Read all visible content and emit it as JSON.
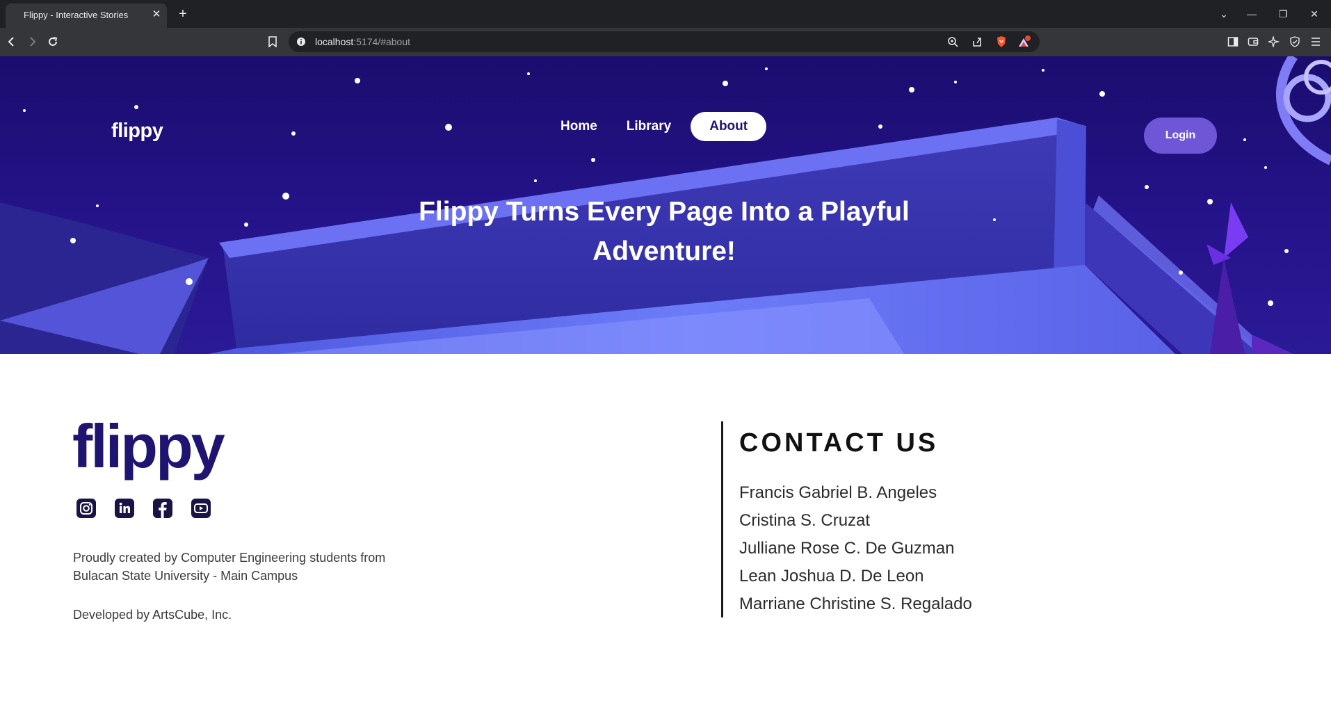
{
  "browser": {
    "tab_title": "Flippy - Interactive Stories",
    "tab_close": "✕",
    "new_tab": "+",
    "url_host": "localhost",
    "url_rest": ":5174/#about",
    "controls": {
      "chevron": "⌄",
      "minimize": "—",
      "restore": "❐",
      "close": "✕"
    },
    "badge_count": "1"
  },
  "header": {
    "logo": "flippy",
    "nav": [
      {
        "label": "Home",
        "active": false
      },
      {
        "label": "Library",
        "active": false
      },
      {
        "label": "About",
        "active": true
      }
    ],
    "login_label": "Login"
  },
  "hero": {
    "title_line1": "Flippy Turns Every Page Into a Playful",
    "title_line2": "Adventure!"
  },
  "footer": {
    "logo": "flippy",
    "socials": [
      "instagram-icon",
      "linkedin-icon",
      "facebook-icon",
      "youtube-icon"
    ],
    "credit_line1": "Proudly created by Computer Engineering students from",
    "credit_line2": "Bulacan State University - Main Campus",
    "developer": "Developed by ArtsCube, Inc.",
    "contact_title": "CONTACT US",
    "contacts": [
      "Francis Gabriel B. Angeles",
      "Cristina S. Cruzat",
      "Julliane Rose C. De Guzman",
      "Lean Joshua D. De Leon",
      "Marriane Christine S. Regalado"
    ]
  },
  "colors": {
    "brand_dark": "#1f1470",
    "hero_bg": "#1a0d6e",
    "login_bg": "#6e56d6",
    "nav_active_bg": "#ffffff"
  }
}
